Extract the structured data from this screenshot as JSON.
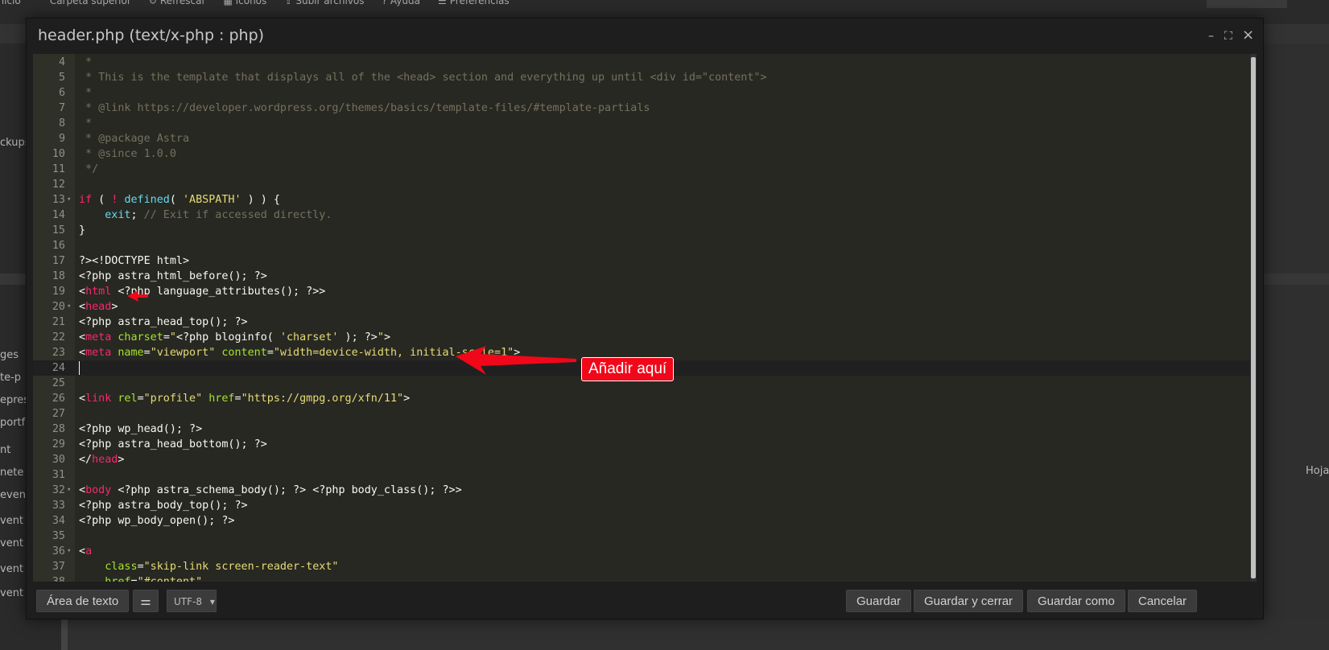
{
  "toolbar": {
    "items": [
      {
        "label": "Inicio",
        "icon": "home-icon"
      },
      {
        "label": "Carpeta superior",
        "icon": "chevron-up-icon"
      },
      {
        "label": "Refrescar",
        "icon": "refresh-icon"
      },
      {
        "label": "iconos",
        "icon": "grid-icon"
      },
      {
        "label": "Subir archivos",
        "icon": "upload-icon"
      },
      {
        "label": "Ayuda",
        "icon": "help-icon"
      },
      {
        "label": "Preferencias",
        "icon": "sliders-icon"
      }
    ]
  },
  "sidebar": {
    "items": [
      "ckups",
      "ges",
      "te-p",
      "epres",
      "portf",
      "nt",
      "nete",
      "event",
      "vent",
      "vent",
      "vent",
      "vent"
    ]
  },
  "right_panel": {
    "label": "Hoja"
  },
  "modal": {
    "title": "header.php (text/x-php : php)",
    "controls": {
      "minimize": "–",
      "maximize": "⛶",
      "close": "×"
    }
  },
  "editor": {
    "lines": [
      {
        "n": "4",
        "fold": "",
        "active": false,
        "tokens": [
          {
            "c": "comment",
            "t": " *"
          }
        ]
      },
      {
        "n": "5",
        "fold": "",
        "active": false,
        "tokens": [
          {
            "c": "comment",
            "t": " * This is the template that displays all of the <head> section and everything up until <div id=\"content\">"
          }
        ]
      },
      {
        "n": "6",
        "fold": "",
        "active": false,
        "tokens": [
          {
            "c": "comment",
            "t": " *"
          }
        ]
      },
      {
        "n": "7",
        "fold": "",
        "active": false,
        "tokens": [
          {
            "c": "comment",
            "t": " * @link https://developer.wordpress.org/themes/basics/template-files/#template-partials"
          }
        ]
      },
      {
        "n": "8",
        "fold": "",
        "active": false,
        "tokens": [
          {
            "c": "comment",
            "t": " *"
          }
        ]
      },
      {
        "n": "9",
        "fold": "",
        "active": false,
        "tokens": [
          {
            "c": "comment",
            "t": " * @package Astra"
          }
        ]
      },
      {
        "n": "10",
        "fold": "",
        "active": false,
        "tokens": [
          {
            "c": "comment",
            "t": " * @since 1.0.0"
          }
        ]
      },
      {
        "n": "11",
        "fold": "",
        "active": false,
        "tokens": [
          {
            "c": "comment",
            "t": " */"
          }
        ]
      },
      {
        "n": "12",
        "fold": "",
        "active": false,
        "tokens": []
      },
      {
        "n": "13",
        "fold": "▾",
        "active": false,
        "tokens": [
          {
            "c": "keyword",
            "t": "if"
          },
          {
            "c": "text",
            "t": " ( "
          },
          {
            "c": "keyword",
            "t": "!"
          },
          {
            "c": "text",
            "t": " "
          },
          {
            "c": "func",
            "t": "defined"
          },
          {
            "c": "text",
            "t": "( "
          },
          {
            "c": "string",
            "t": "'ABSPATH'"
          },
          {
            "c": "text",
            "t": " ) ) {"
          }
        ]
      },
      {
        "n": "14",
        "fold": "",
        "active": false,
        "tokens": [
          {
            "c": "text",
            "t": "    "
          },
          {
            "c": "func",
            "t": "exit"
          },
          {
            "c": "text",
            "t": "; "
          },
          {
            "c": "comment",
            "t": "// Exit if accessed directly."
          }
        ]
      },
      {
        "n": "15",
        "fold": "",
        "active": false,
        "tokens": [
          {
            "c": "text",
            "t": "}"
          }
        ]
      },
      {
        "n": "16",
        "fold": "",
        "active": false,
        "tokens": []
      },
      {
        "n": "17",
        "fold": "",
        "active": false,
        "tokens": [
          {
            "c": "text",
            "t": "?><!DOCTYPE html>"
          }
        ]
      },
      {
        "n": "18",
        "fold": "",
        "active": false,
        "tokens": [
          {
            "c": "text",
            "t": "<?php astra_html_before(); ?>"
          }
        ]
      },
      {
        "n": "19",
        "fold": "",
        "active": false,
        "tokens": [
          {
            "c": "text",
            "t": "<"
          },
          {
            "c": "keyword",
            "t": "html"
          },
          {
            "c": "text",
            "t": " <?php language_attributes(); ?>>"
          }
        ]
      },
      {
        "n": "20",
        "fold": "▾",
        "active": false,
        "tokens": [
          {
            "c": "text",
            "t": "<"
          },
          {
            "c": "keyword",
            "t": "head"
          },
          {
            "c": "text",
            "t": ">"
          }
        ]
      },
      {
        "n": "21",
        "fold": "",
        "active": false,
        "tokens": [
          {
            "c": "text",
            "t": "<?php astra_head_top(); ?>"
          }
        ]
      },
      {
        "n": "22",
        "fold": "",
        "active": false,
        "tokens": [
          {
            "c": "text",
            "t": "<"
          },
          {
            "c": "keyword",
            "t": "meta"
          },
          {
            "c": "text",
            "t": " "
          },
          {
            "c": "attr",
            "t": "charset"
          },
          {
            "c": "text",
            "t": "="
          },
          {
            "c": "string",
            "t": "\""
          },
          {
            "c": "text",
            "t": "<?php bloginfo( "
          },
          {
            "c": "string",
            "t": "'charset'"
          },
          {
            "c": "text",
            "t": " ); ?>"
          },
          {
            "c": "string",
            "t": "\""
          },
          {
            "c": "text",
            "t": ">"
          }
        ]
      },
      {
        "n": "23",
        "fold": "",
        "active": false,
        "tokens": [
          {
            "c": "text",
            "t": "<"
          },
          {
            "c": "keyword",
            "t": "meta"
          },
          {
            "c": "text",
            "t": " "
          },
          {
            "c": "attr",
            "t": "name"
          },
          {
            "c": "text",
            "t": "="
          },
          {
            "c": "string",
            "t": "\"viewport\""
          },
          {
            "c": "text",
            "t": " "
          },
          {
            "c": "attr",
            "t": "content"
          },
          {
            "c": "text",
            "t": "="
          },
          {
            "c": "string",
            "t": "\"width=device-width, initial-scale=1\""
          },
          {
            "c": "text",
            "t": ">"
          }
        ]
      },
      {
        "n": "24",
        "fold": "",
        "active": true,
        "tokens": []
      },
      {
        "n": "25",
        "fold": "",
        "active": false,
        "tokens": []
      },
      {
        "n": "26",
        "fold": "",
        "active": false,
        "tokens": [
          {
            "c": "text",
            "t": "<"
          },
          {
            "c": "keyword",
            "t": "link"
          },
          {
            "c": "text",
            "t": " "
          },
          {
            "c": "attr",
            "t": "rel"
          },
          {
            "c": "text",
            "t": "="
          },
          {
            "c": "string",
            "t": "\"profile\""
          },
          {
            "c": "text",
            "t": " "
          },
          {
            "c": "attr",
            "t": "href"
          },
          {
            "c": "text",
            "t": "="
          },
          {
            "c": "string",
            "t": "\"https://gmpg.org/xfn/11\""
          },
          {
            "c": "text",
            "t": ">"
          }
        ]
      },
      {
        "n": "27",
        "fold": "",
        "active": false,
        "tokens": []
      },
      {
        "n": "28",
        "fold": "",
        "active": false,
        "tokens": [
          {
            "c": "text",
            "t": "<?php wp_head(); ?>"
          }
        ]
      },
      {
        "n": "29",
        "fold": "",
        "active": false,
        "tokens": [
          {
            "c": "text",
            "t": "<?php astra_head_bottom(); ?>"
          }
        ]
      },
      {
        "n": "30",
        "fold": "",
        "active": false,
        "tokens": [
          {
            "c": "text",
            "t": "</"
          },
          {
            "c": "keyword",
            "t": "head"
          },
          {
            "c": "text",
            "t": ">"
          }
        ]
      },
      {
        "n": "31",
        "fold": "",
        "active": false,
        "tokens": []
      },
      {
        "n": "32",
        "fold": "▾",
        "active": false,
        "tokens": [
          {
            "c": "text",
            "t": "<"
          },
          {
            "c": "keyword",
            "t": "body"
          },
          {
            "c": "text",
            "t": " <?php astra_schema_body(); ?> <?php body_class(); ?>>"
          }
        ]
      },
      {
        "n": "33",
        "fold": "",
        "active": false,
        "tokens": [
          {
            "c": "text",
            "t": "<?php astra_body_top(); ?>"
          }
        ]
      },
      {
        "n": "34",
        "fold": "",
        "active": false,
        "tokens": [
          {
            "c": "text",
            "t": "<?php wp_body_open(); ?>"
          }
        ]
      },
      {
        "n": "35",
        "fold": "",
        "active": false,
        "tokens": []
      },
      {
        "n": "36",
        "fold": "▾",
        "active": false,
        "tokens": [
          {
            "c": "text",
            "t": "<"
          },
          {
            "c": "keyword",
            "t": "a"
          }
        ]
      },
      {
        "n": "37",
        "fold": "",
        "active": false,
        "tokens": [
          {
            "c": "text",
            "t": "    "
          },
          {
            "c": "attr",
            "t": "class"
          },
          {
            "c": "text",
            "t": "="
          },
          {
            "c": "string",
            "t": "\"skip-link screen-reader-text\""
          }
        ]
      },
      {
        "n": "38",
        "fold": "",
        "active": false,
        "tokens": [
          {
            "c": "text",
            "t": "    "
          },
          {
            "c": "attr",
            "t": "href"
          },
          {
            "c": "text",
            "t": "="
          },
          {
            "c": "string",
            "t": "\"#content\""
          }
        ]
      }
    ]
  },
  "annotation": {
    "callout": "Añadir aquí",
    "color": "#f0071a"
  },
  "footer": {
    "mode_button": "Área de texto",
    "encoding": "UTF-8",
    "save": "Guardar",
    "save_close": "Guardar y cerrar",
    "save_as": "Guardar como",
    "cancel": "Cancelar"
  }
}
